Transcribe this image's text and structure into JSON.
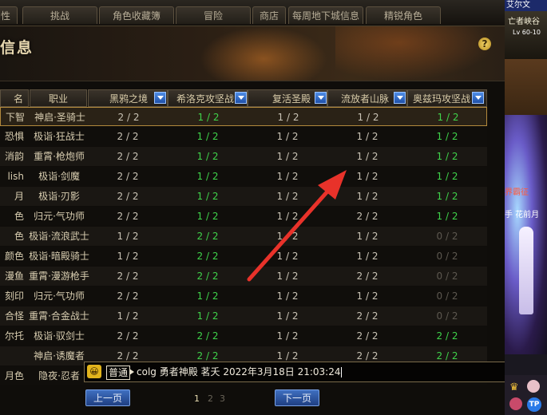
{
  "tabs": [
    {
      "label": "性"
    },
    {
      "label": "挑战"
    },
    {
      "label": "角色收藏簿"
    },
    {
      "label": "冒险"
    },
    {
      "label": "商店"
    },
    {
      "label": "每周地下城信息"
    },
    {
      "label": "精锐角色"
    }
  ],
  "header": {
    "title": "信息",
    "help": "?"
  },
  "table": {
    "columns": [
      "名",
      "职业",
      "黑鸦之境",
      "希洛克攻坚战",
      "复活圣殿",
      "流放者山脉",
      "奥兹玛攻坚战"
    ],
    "rows": [
      {
        "name": "下智",
        "job": "神启·圣骑士",
        "v": [
          "2 / 2",
          "1 / 2",
          "1 / 2",
          "1 / 2",
          "1 / 2"
        ]
      },
      {
        "name": "恐惧",
        "job": "极诣·狂战士",
        "v": [
          "2 / 2",
          "1 / 2",
          "1 / 2",
          "1 / 2",
          "1 / 2"
        ]
      },
      {
        "name": "消韵",
        "job": "重霄·枪炮师",
        "v": [
          "2 / 2",
          "1 / 2",
          "1 / 2",
          "1 / 2",
          "1 / 2"
        ]
      },
      {
        "name": "lish",
        "job": "极诣·剑魔",
        "v": [
          "2 / 2",
          "1 / 2",
          "1 / 2",
          "1 / 2",
          "1 / 2"
        ]
      },
      {
        "name": "月",
        "job": "极诣·刃影",
        "v": [
          "2 / 2",
          "1 / 2",
          "1 / 2",
          "1 / 2",
          "1 / 2"
        ]
      },
      {
        "name": "色",
        "job": "归元·气功师",
        "v": [
          "2 / 2",
          "1 / 2",
          "1 / 2",
          "2 / 2",
          "1 / 2"
        ]
      },
      {
        "name": "色",
        "job": "极诣·流浪武士",
        "v": [
          "1 / 2",
          "2 / 2",
          "1 / 2",
          "1 / 2",
          "0 / 2"
        ]
      },
      {
        "name": "颜色",
        "job": "极诣·暗殿骑士",
        "v": [
          "1 / 2",
          "2 / 2",
          "1 / 2",
          "1 / 2",
          "0 / 2"
        ]
      },
      {
        "name": "漫鱼",
        "job": "重霄·漫游枪手",
        "v": [
          "2 / 2",
          "2 / 2",
          "1 / 2",
          "2 / 2",
          "0 / 2"
        ]
      },
      {
        "name": "刻印",
        "job": "归元·气功师",
        "v": [
          "2 / 2",
          "1 / 2",
          "1 / 2",
          "1 / 2",
          "0 / 2"
        ]
      },
      {
        "name": "合怪",
        "job": "重霄·合金战士",
        "v": [
          "1 / 2",
          "1 / 2",
          "1 / 2",
          "2 / 2",
          "0 / 2"
        ]
      },
      {
        "name": "尔托",
        "job": "极诣·驭剑士",
        "v": [
          "2 / 2",
          "2 / 2",
          "1 / 2",
          "2 / 2",
          "2 / 2"
        ]
      },
      {
        "name": "",
        "job": "神启·诱魔者",
        "v": [
          "2 / 2",
          "2 / 2",
          "1 / 2",
          "2 / 2",
          "2 / 2"
        ]
      },
      {
        "name": "月色",
        "job": "隐夜·忍者",
        "v": [
          "",
          "",
          "",
          "",
          ""
        ]
      }
    ]
  },
  "chat": {
    "channel": "普通",
    "text": "colg 勇者神殿 茗夭 2022年3月18日 21:03:24"
  },
  "pager": {
    "prev": "上一页",
    "next": "下一页",
    "pages": [
      "1",
      "2",
      "3"
    ]
  },
  "side": {
    "name": "艾尔文",
    "title": "亡者峡谷",
    "level": "Lv 60-10",
    "event": "界霸征",
    "flower": "手 花前月"
  },
  "colors": {
    "green": "#3fd24a",
    "gray": "#c9c3b5",
    "accent": "#b38a3c"
  }
}
